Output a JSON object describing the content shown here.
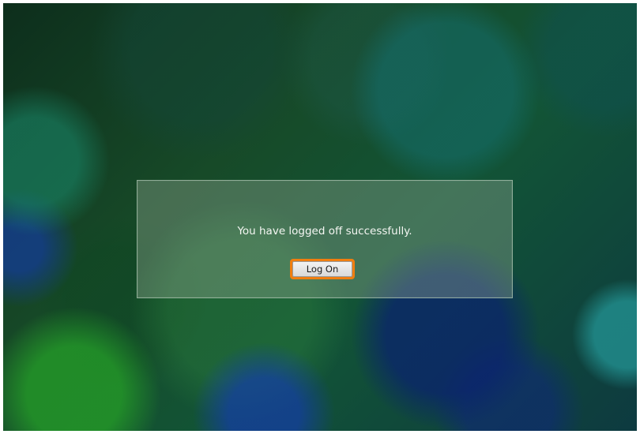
{
  "logoff_dialog": {
    "message": "You have logged off successfully.",
    "logon_button_label": "Log On"
  },
  "colors": {
    "focus_ring": "#f07e10",
    "background_tint": "#174a28"
  }
}
